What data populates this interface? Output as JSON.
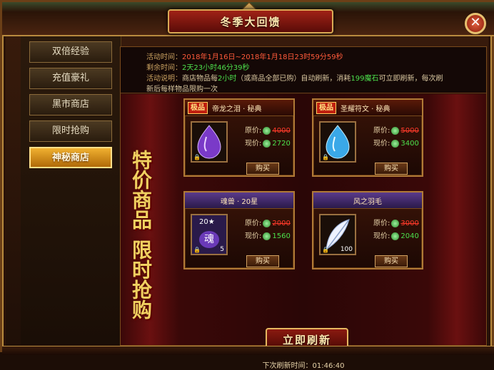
{
  "window": {
    "title": "冬季大回馈",
    "close_label": "✕"
  },
  "nav": {
    "items": [
      {
        "label": "双倍经验",
        "active": false
      },
      {
        "label": "充值豪礼",
        "active": false
      },
      {
        "label": "黑市商店",
        "active": false
      },
      {
        "label": "限时抢购",
        "active": false
      },
      {
        "label": "神秘商店",
        "active": true
      }
    ]
  },
  "info": {
    "time_label": "活动时间：",
    "time_value": "2018年1月16日~2018年1月18日23时59分59秒",
    "remain_label": "剩余时间：",
    "remain_value": "2天23小时46分39秒",
    "desc_label": "活动说明：",
    "desc_part1": "商店物品每",
    "desc_interval": "2小时",
    "desc_part2": "（或商品全部已购）自动刷新，消耗",
    "desc_cost": "199魔石",
    "desc_part3": "可立即刷新，每次刷",
    "desc_line2": "新后每样物品限购一次"
  },
  "banner": {
    "line1": "特价商品",
    "line2": "限时抢购"
  },
  "items": [
    {
      "tag": "极品",
      "name": "帝龙之泪 · 秘典",
      "original_label": "原价:",
      "original": "4000",
      "now_label": "现价:",
      "now": "2720",
      "buy": "购买",
      "qty": "",
      "level": ""
    },
    {
      "tag": "极品",
      "name": "圣耀符文 · 秘典",
      "original_label": "原价:",
      "original": "5000",
      "now_label": "现价:",
      "now": "3400",
      "buy": "购买",
      "qty": "",
      "level": ""
    },
    {
      "tag": "",
      "name": "魂兽 · 20星",
      "original_label": "原价:",
      "original": "2000",
      "now_label": "现价:",
      "now": "1560",
      "buy": "购买",
      "qty": "5",
      "level": "20★",
      "glyph": "魂"
    },
    {
      "tag": "",
      "name": "风之羽毛",
      "original_label": "原价:",
      "original": "3000",
      "now_label": "现价:",
      "now": "2040",
      "buy": "购买",
      "qty": "100",
      "level": ""
    }
  ],
  "refresh": {
    "label": "立即刷新",
    "next_label": "下次刷新时间：",
    "next_time": "01:46:40"
  },
  "colors": {
    "accent_gold": "#d9aa55",
    "active_tab": "#f0b030",
    "price_now": "#4ce04c",
    "price_old": "#ff3a2a"
  }
}
